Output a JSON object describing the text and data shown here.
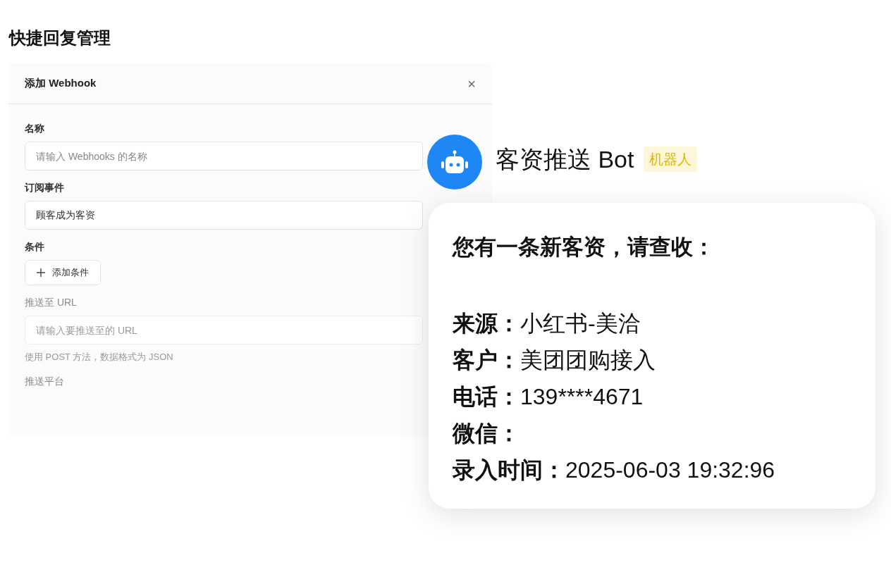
{
  "page_title": "快捷回复管理",
  "dialog": {
    "title": "添加 Webhook",
    "close": "×",
    "fields": [
      {
        "kind": "input",
        "label": "名称",
        "placeholder": "请输入 Webhooks 的名称",
        "faded": false
      },
      {
        "kind": "input",
        "label": "订阅事件",
        "value": "顾客成为客资",
        "faded": false
      },
      {
        "kind": "button",
        "label": "条件",
        "button": "添加条件",
        "faded": false
      },
      {
        "kind": "input",
        "label": "推送至 URL",
        "placeholder": "请输入要推送至的 URL",
        "hint": "使用 POST 方法，数据格式为 JSON",
        "faded": true
      },
      {
        "kind": "label",
        "label": "推送平台",
        "faded": true
      }
    ]
  },
  "bot": {
    "name": "客资推送 Bot",
    "badge": "机器人"
  },
  "message": {
    "heading": "您有一条新客资，请查收：",
    "lines": [
      {
        "label": "来源：",
        "value": "小红书-美洽"
      },
      {
        "label": "客户：",
        "value": "美团团购接入"
      },
      {
        "label": "电话：",
        "value": "139****4671"
      },
      {
        "label": "微信："
      },
      {
        "label": "录入时间：",
        "value": "2025-06-03 19:32:96"
      }
    ]
  }
}
